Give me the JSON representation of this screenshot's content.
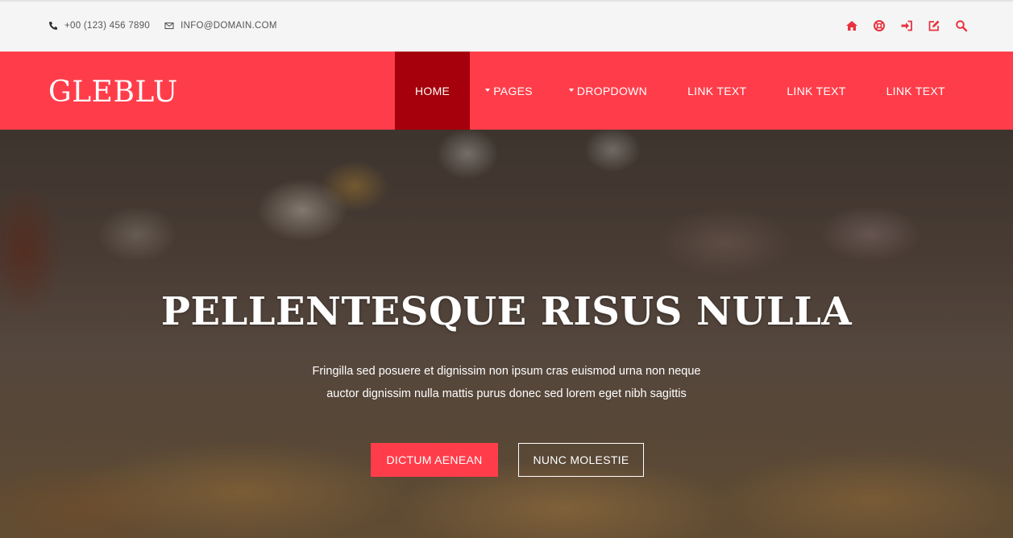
{
  "topbar": {
    "phone": "+00 (123) 456 7890",
    "email": "INFO@DOMAIN.COM",
    "tools": [
      {
        "icon": "home-icon"
      },
      {
        "icon": "life-ring-icon"
      },
      {
        "icon": "sign-in-icon"
      },
      {
        "icon": "edit-icon"
      },
      {
        "icon": "search-icon"
      }
    ]
  },
  "navbar": {
    "brand": "GLEBLU",
    "items": [
      {
        "label": "HOME",
        "active": true
      },
      {
        "label": "PAGES",
        "dropdown": true
      },
      {
        "label": "DROPDOWN",
        "dropdown": true
      },
      {
        "label": "LINK TEXT"
      },
      {
        "label": "LINK TEXT"
      },
      {
        "label": "LINK TEXT"
      }
    ]
  },
  "hero": {
    "title": "PELLENTESQUE RISUS NULLA",
    "text_line1": "Fringilla sed posuere et dignissim non ipsum cras euismod urna non neque",
    "text_line2": "auctor dignissim nulla mattis purus donec sed lorem eget nibh sagittis",
    "primary_button": "DICTUM AENEAN",
    "secondary_button": "NUNC MOLESTIE"
  },
  "colors": {
    "accent": "#ff3d4a",
    "active_nav": "#a5000b",
    "topbar_bg": "#f5f5f5"
  }
}
